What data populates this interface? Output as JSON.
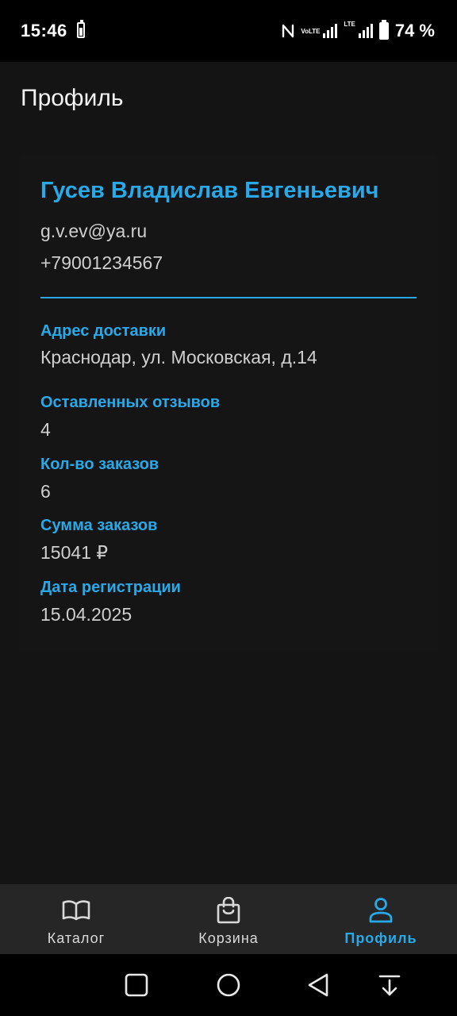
{
  "status_bar": {
    "time": "15:46",
    "volte_text": "VoLTE",
    "lte_text": "LTE",
    "battery_percent": "74 %"
  },
  "app_bar": {
    "title": "Профиль"
  },
  "profile": {
    "name": "Гусев Владислав Евгеньевич",
    "email": "g.v.ev@ya.ru",
    "phone": "+79001234567",
    "fields": [
      {
        "label": "Адрес доставки",
        "value": "Краснодар, ул. Московская, д.14"
      },
      {
        "label": "Оставленных отзывов",
        "value": "4"
      },
      {
        "label": "Кол-во заказов",
        "value": "6"
      },
      {
        "label": "Сумма заказов",
        "value": "15041 ₽"
      },
      {
        "label": "Дата регистрации",
        "value": "15.04.2025"
      }
    ]
  },
  "bottom_nav": {
    "items": [
      {
        "label": "Каталог",
        "icon": "book-icon",
        "active": false
      },
      {
        "label": "Корзина",
        "icon": "shopping-bag-icon",
        "active": false
      },
      {
        "label": "Профиль",
        "icon": "person-icon",
        "active": true
      }
    ]
  },
  "system_nav": {
    "buttons": [
      "recents-icon",
      "home-icon",
      "back-icon",
      "notification-pull-icon"
    ]
  },
  "colors": {
    "accent": "#29a9e8",
    "background": "#141414",
    "nav_background": "#262626"
  }
}
